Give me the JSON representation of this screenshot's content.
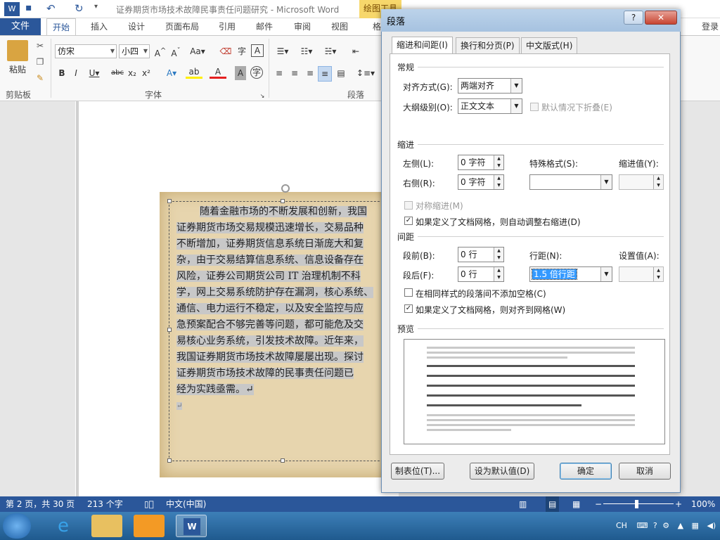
{
  "window": {
    "title": "证券期货市场技术故障民事责任问题研究 - Microsoft Word",
    "contextual_tab": "绘图工具"
  },
  "ribbon": {
    "tabs": [
      "文件",
      "开始",
      "插入",
      "设计",
      "页面布局",
      "引用",
      "邮件",
      "审阅",
      "视图",
      "格"
    ],
    "login": "登录",
    "paste_label": "粘贴",
    "font_name": "仿宋",
    "font_size": "小四",
    "groups": {
      "clipboard": "剪贴板",
      "font": "字体",
      "paragraph": "段落"
    }
  },
  "document": {
    "paragraph": "随着金融市场的不断发展和创新，我国证券期货市场交易规模迅速增长，交易品种不断增加，证券期货信息系统日渐庞大和复杂，由于交易结算信息系统、信息设备存在风险，证券公司期货公司 IT 治理机制不科学，网上交易系统防护存在漏洞，核心系统、通信、电力运行不稳定，以及安全监控与应急预案配合不够完善等问题，都可能危及交易核心业务系统，引发技术故障。近年来，我国证券期货市场技术故障屡屡出现。探讨证券期货市场技术故障的民事责任问题已经为实践亟需。",
    "lines": [
      "随着金融市场的不断发展和创新，我国",
      "证券期货市场交易规模迅速增长，交易品种",
      "不断增加，证券期货信息系统日渐庞大和复",
      "杂，由于交易结算信息系统、信息设备存在",
      "风险，证券公司期货公司 IT 治理机制不科",
      "学，网上交易系统防护存在漏洞，核心系统、",
      "通信、电力运行不稳定，以及安全监控与应",
      "急预案配合不够完善等问题，都可能危及交",
      "易核心业务系统，引发技术故障。近年来，",
      "我国证券期货市场技术故障屡屡出现。探讨",
      "证券期货市场技术故障的民事责任问题已",
      "经为实践亟需。↵",
      "↵"
    ]
  },
  "statusbar": {
    "page": "第 2 页，共 30 页",
    "words": "213 个字",
    "language": "中文(中国)",
    "zoom": "100%"
  },
  "taskbar": {
    "ime": "CH"
  },
  "dialog": {
    "title": "段落",
    "help": "?",
    "close": "✕",
    "tabs": [
      "缩进和间距(I)",
      "换行和分页(P)",
      "中文版式(H)"
    ],
    "general": {
      "title": "常规",
      "alignment_label": "对齐方式(G):",
      "alignment_value": "两端对齐",
      "outline_label": "大纲级别(O):",
      "outline_value": "正文文本",
      "collapse_label": "默认情况下折叠(E)"
    },
    "indent": {
      "title": "缩进",
      "left_label": "左侧(L):",
      "left_value": "0 字符",
      "right_label": "右侧(R):",
      "right_value": "0 字符",
      "special_label": "特殊格式(S):",
      "special_value": "",
      "by_label": "缩进值(Y):",
      "by_value": "",
      "mirror_label": "对称缩进(M)",
      "auto_adjust_label": "如果定义了文档网格，则自动调整右缩进(D)"
    },
    "spacing": {
      "title": "间距",
      "before_label": "段前(B):",
      "before_value": "0 行",
      "after_label": "段后(F):",
      "after_value": "0 行",
      "line_label": "行距(N):",
      "line_value": "1.5 倍行距",
      "at_label": "设置值(A):",
      "at_value": "",
      "no_space_label": "在相同样式的段落间不添加空格(C)",
      "snap_grid_label": "如果定义了文档网格，则对齐到网格(W)"
    },
    "preview": {
      "title": "预览"
    },
    "buttons": {
      "tabs": "制表位(T)...",
      "default": "设为默认值(D)",
      "ok": "确定",
      "cancel": "取消"
    }
  }
}
